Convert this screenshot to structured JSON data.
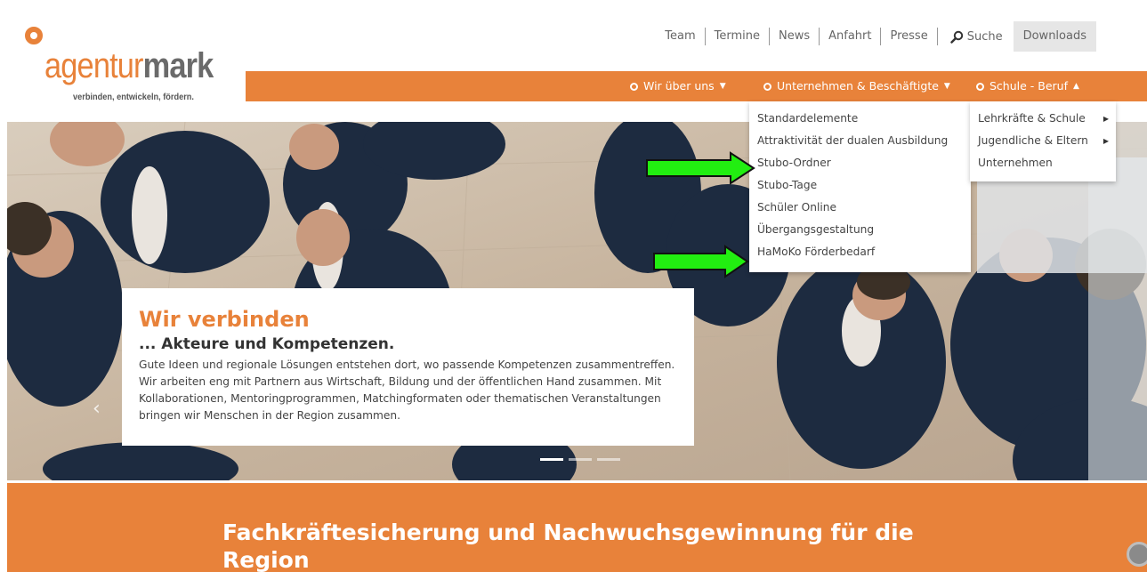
{
  "logo": {
    "word_light": "agentur",
    "word_bold": "mark",
    "claim": "verbinden, entwickeln, fördern."
  },
  "top_links": [
    "Team",
    "Termine",
    "News",
    "Anfahrt",
    "Presse"
  ],
  "search_label": "Suche",
  "downloads_label": "Downloads",
  "nav": [
    {
      "label": "Wir über uns",
      "caret": "▼"
    },
    {
      "label": "Unternehmen & Beschäftigte",
      "caret": "▼"
    },
    {
      "label": "Schule - Beruf",
      "caret": "▲"
    }
  ],
  "dropdown_main": [
    "Standardelemente",
    "Attraktivität der dualen Ausbildung",
    "Stubo-Ordner",
    "Stubo-Tage",
    "Schüler Online",
    "Übergangsgestaltung",
    "HaMoKo Förderbedarf"
  ],
  "dropdown_side": [
    {
      "label": "Lehrkräfte & Schule",
      "has_sub": true
    },
    {
      "label": "Jugendliche & Eltern",
      "has_sub": true
    },
    {
      "label": "Unternehmen",
      "has_sub": false
    }
  ],
  "hero": {
    "title": "Wir verbinden",
    "subtitle": "... Akteure und Kompetenzen.",
    "text": "Gute Ideen und regionale Lösungen entstehen dort, wo passende Kompetenzen zusammentreffen. Wir arbeiten eng mit Partnern aus Wirtschaft, Bildung und der öffentlichen Hand zusammen. Mit Kollaborationen, Mentoringprogrammen, Matchingformaten oder thematischen Veranstaltungen bringen wir Menschen in der Region zusammen."
  },
  "band_title": "Fachkräftesicherung und Nachwuchsgewinnung für die Region",
  "colors": {
    "brand_orange": "#e8823a",
    "annotation_green": "#22ee11"
  },
  "icons": [
    "search-icon",
    "chevron-left-icon",
    "chat-icon"
  ]
}
